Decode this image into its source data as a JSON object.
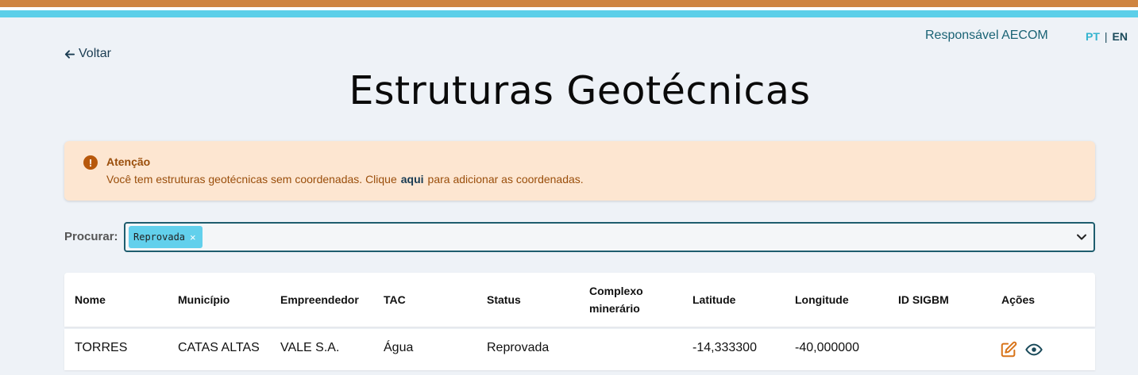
{
  "header": {
    "user_label": "Responsável AECOM",
    "lang_pt": "PT",
    "lang_sep": "|",
    "lang_en": "EN"
  },
  "back_label": "Voltar",
  "page_title": "Estruturas Geotécnicas",
  "alert": {
    "title": "Atenção",
    "message_before": "Você tem estruturas geotécnicas sem coordenadas. Clique",
    "link": "aqui",
    "message_after": "para adicionar as coordenadas."
  },
  "search": {
    "label": "Procurar:",
    "chips": [
      "Reprovada"
    ]
  },
  "table": {
    "headers": [
      "Nome",
      "Município",
      "Empreendedor",
      "TAC",
      "Status",
      "Complexo minerário",
      "Latitude",
      "Longitude",
      "ID SIGBM",
      "Ações"
    ],
    "rows": [
      {
        "nome": "TORRES",
        "municipio": "CATAS ALTAS",
        "empreendedor": "VALE S.A.",
        "tac": "Água",
        "status": "Reprovada",
        "complexo": "",
        "latitude": "-14,333300",
        "longitude": "-40,000000",
        "id_sigbm": ""
      }
    ]
  },
  "colors": {
    "accent_orange": "#cf8440",
    "accent_blue": "#5ccfe9",
    "alert_bg": "#fde6d1",
    "action_edit": "#d8741a",
    "action_view": "#1a4a5a"
  },
  "icons": {
    "back": "arrow-left-icon",
    "alert": "exclamation-circle-icon",
    "chip_remove": "close-icon",
    "dropdown": "chevron-down-icon",
    "edit": "edit-icon",
    "view": "eye-icon"
  }
}
